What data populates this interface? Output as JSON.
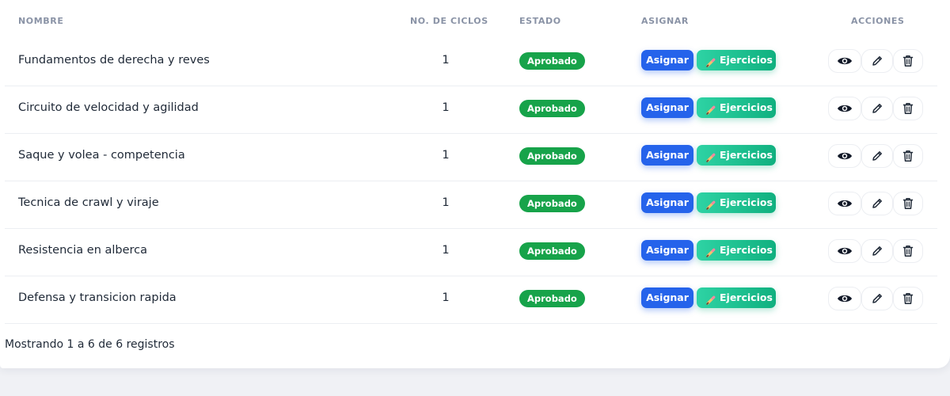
{
  "table": {
    "headers": {
      "nombre": "NOMBRE",
      "ciclos": "NO. DE CICLOS",
      "estado": "ESTADO",
      "asignar": "ASIGNAR",
      "acciones": "ACCIONES"
    },
    "rows": [
      {
        "nombre": "Fundamentos de derecha y reves",
        "ciclos": "1",
        "estado": "Aprobado",
        "asignar_label": "Asignar",
        "ejercicios_label": "Ejercicios"
      },
      {
        "nombre": "Circuito de velocidad y agilidad",
        "ciclos": "1",
        "estado": "Aprobado",
        "asignar_label": "Asignar",
        "ejercicios_label": "Ejercicios"
      },
      {
        "nombre": "Saque y volea - competencia",
        "ciclos": "1",
        "estado": "Aprobado",
        "asignar_label": "Asignar",
        "ejercicios_label": "Ejercicios"
      },
      {
        "nombre": "Tecnica de crawl y viraje",
        "ciclos": "1",
        "estado": "Aprobado",
        "asignar_label": "Asignar",
        "ejercicios_label": "Ejercicios"
      },
      {
        "nombre": "Resistencia en alberca",
        "ciclos": "1",
        "estado": "Aprobado",
        "asignar_label": "Asignar",
        "ejercicios_label": "Ejercicios"
      },
      {
        "nombre": "Defensa y transicion rapida",
        "ciclos": "1",
        "estado": "Aprobado",
        "asignar_label": "Asignar",
        "ejercicios_label": "Ejercicios"
      }
    ],
    "icons": {
      "ejercicios": "pencil-icon",
      "view": "eye-icon",
      "edit": "edit-pencil-icon",
      "delete": "trash-icon"
    }
  },
  "footer": {
    "summary": "Mostrando 1 a 6 de 6 registros"
  },
  "colors": {
    "status_aprobado": "#17a34a",
    "asignar_button": "#2563eb",
    "ejercicios_button": "#10b07f",
    "header_text": "#8a93a6"
  }
}
